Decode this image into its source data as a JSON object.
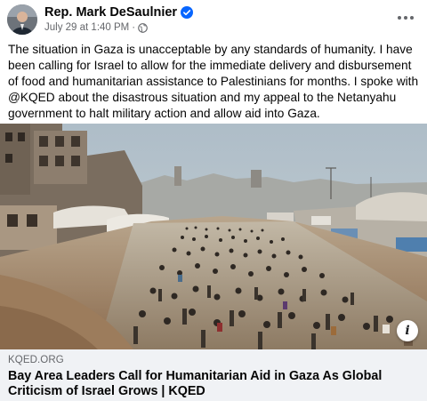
{
  "post": {
    "author": "Rep. Mark DeSaulnier",
    "date": "July 29 at 1:40 PM",
    "separator": "·",
    "body": "The situation in Gaza is unacceptable by any standards of humanity. I have been calling for Israel to allow for the immediate delivery and disbursement of food and humanitarian assistance to Palestinians for months. I spoke with @KQED about the disastrous situation and my appeal to the Netanyahu government to halt military action and allow aid into Gaza."
  },
  "link_preview": {
    "domain": "KQED.ORG",
    "title": "Bay Area Leaders Call for Humanitarian Aid in Gaza As Global Criticism of Israel Grows | KQED",
    "info_glyph": "i"
  },
  "icons": {
    "verified": "verified-badge-icon",
    "audience": "globe-icon",
    "more": "more-options-icon",
    "info": "info-icon"
  },
  "colors": {
    "verified": "#0866ff",
    "secondary_text": "#65676b",
    "link_card_bg": "#f0f2f5"
  }
}
